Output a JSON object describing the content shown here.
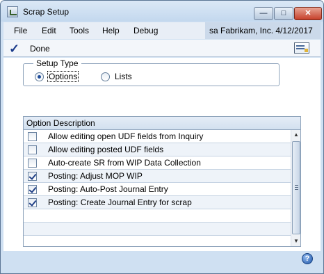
{
  "window": {
    "title": "Scrap Setup",
    "controls": {
      "minimize": "—",
      "maximize": "□",
      "close": "✕"
    }
  },
  "menubar": {
    "items": [
      "File",
      "Edit",
      "Tools",
      "Help",
      "Debug"
    ],
    "company_info": "sa  Fabrikam, Inc.  4/12/2017"
  },
  "toolbar": {
    "done_label": "Done",
    "icons": [
      "done-check-icon",
      "note-icon"
    ]
  },
  "setup_type": {
    "legend": "Setup Type",
    "options": [
      {
        "label": "Options",
        "selected": true
      },
      {
        "label": "Lists",
        "selected": false
      }
    ]
  },
  "grid": {
    "header": "Option Description",
    "rows": [
      {
        "label": "Allow editing open UDF fields from Inquiry",
        "checked": false
      },
      {
        "label": "Allow editing posted UDF fields",
        "checked": false
      },
      {
        "label": "Auto-create SR from WIP Data Collection",
        "checked": false
      },
      {
        "label": "Posting: Adjust MOP WIP",
        "checked": true
      },
      {
        "label": "Posting: Auto-Post Journal Entry",
        "checked": true
      },
      {
        "label": "Posting: Create Journal Entry for scrap",
        "checked": true
      },
      {
        "label": "",
        "checked": null
      },
      {
        "label": "",
        "checked": null
      }
    ]
  },
  "footer": {
    "help_icon": "?"
  },
  "colors": {
    "accent": "#1f4d9a",
    "window_bg": "#cfe0f2",
    "grid_header": "#d2e0ef"
  }
}
